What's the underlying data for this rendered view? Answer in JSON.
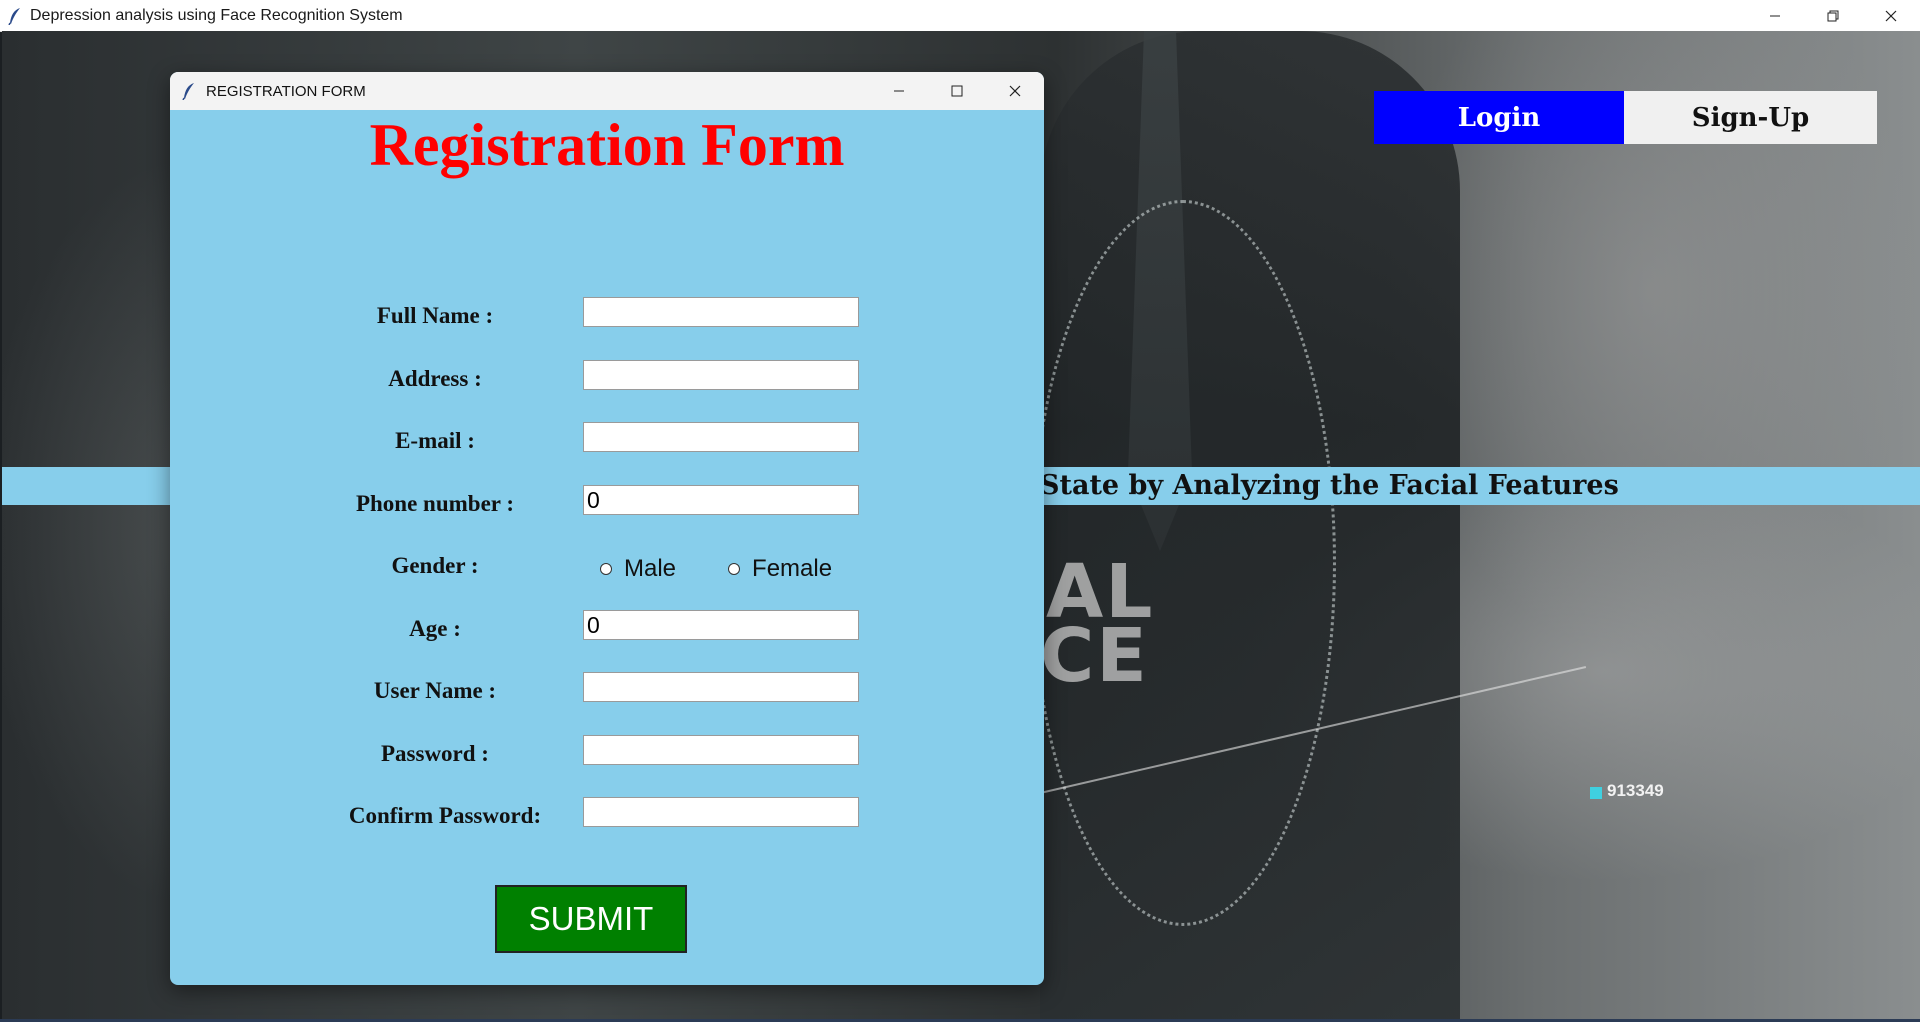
{
  "main_window": {
    "title": "Depression analysis using Face Recognition System",
    "icon": "feather-icon"
  },
  "background": {
    "banner_text": "State by Analyzing the Facial Features",
    "ai_text_line1": "AL",
    "ai_text_line2": "CE",
    "number_label": "913349"
  },
  "nav": {
    "login_label": "Login",
    "signup_label": "Sign-Up",
    "login_color": "#0000ff",
    "signup_color": "#f0f0f0"
  },
  "dialog": {
    "title": "REGISTRATION FORM",
    "heading": "Registration Form",
    "heading_color": "#ff0000",
    "background_color": "#87ceeb",
    "fields": [
      {
        "label": "Full Name :",
        "value": ""
      },
      {
        "label": "Address :",
        "value": ""
      },
      {
        "label": "E-mail :",
        "value": ""
      },
      {
        "label": "Phone number :",
        "value": "0"
      },
      {
        "label": "Gender :"
      },
      {
        "label": "Age :",
        "value": "0"
      },
      {
        "label": "User Name :",
        "value": ""
      },
      {
        "label": "Password :",
        "value": ""
      },
      {
        "label": "Confirm Password:",
        "value": ""
      }
    ],
    "gender_options": [
      "Male",
      "Female"
    ],
    "submit_label": "SUBMIT",
    "submit_color": "#008000"
  }
}
